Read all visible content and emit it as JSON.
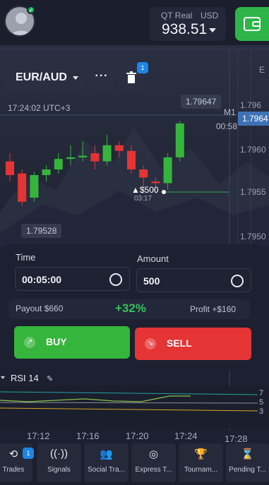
{
  "header": {
    "account_label": "QT Real",
    "currency": "USD",
    "balance": "938.51",
    "avatar_badge": "✓"
  },
  "chart": {
    "pair": "EUR/AUD",
    "more_label": "···",
    "trash_badge": "1",
    "timestamp": "17:24:02 UTC+3",
    "high_tag": "1.79647",
    "low_tag": "1.79528",
    "current_price": "1.7964",
    "timeframe": "M1",
    "timeframe_countdown": "00:58",
    "deal_label": "▲$500",
    "deal_time": "03:17",
    "price_axis": [
      "1.796",
      "1.7960",
      "1.7955",
      "1.7950"
    ],
    "top_right_label": "E",
    "chart_data": {
      "type": "candlestick",
      "colors": {
        "up": "#36b53c",
        "down": "#e53434"
      },
      "candles": [
        {
          "o": 1.79595,
          "h": 1.79605,
          "c": 1.79578,
          "l": 1.7957
        },
        {
          "o": 1.7958,
          "h": 1.79585,
          "c": 1.79545,
          "l": 1.7954
        },
        {
          "o": 1.7955,
          "h": 1.79582,
          "c": 1.79578,
          "l": 1.79545
        },
        {
          "o": 1.79578,
          "h": 1.7959,
          "c": 1.79585,
          "l": 1.7957
        },
        {
          "o": 1.79585,
          "h": 1.79605,
          "c": 1.79598,
          "l": 1.7958
        },
        {
          "o": 1.79598,
          "h": 1.79615,
          "c": 1.796,
          "l": 1.7959
        },
        {
          "o": 1.796,
          "h": 1.7962,
          "c": 1.79602,
          "l": 1.79595
        },
        {
          "o": 1.79605,
          "h": 1.79615,
          "c": 1.79595,
          "l": 1.79585
        },
        {
          "o": 1.79595,
          "h": 1.79628,
          "c": 1.79615,
          "l": 1.7959
        },
        {
          "o": 1.79615,
          "h": 1.7962,
          "c": 1.79608,
          "l": 1.796
        },
        {
          "o": 1.79608,
          "h": 1.79615,
          "c": 1.79585,
          "l": 1.7958
        },
        {
          "o": 1.79585,
          "h": 1.7959,
          "c": 1.79575,
          "l": 1.7956
        },
        {
          "o": 1.7957,
          "h": 1.79575,
          "c": 1.79568,
          "l": 1.79555
        },
        {
          "o": 1.79568,
          "h": 1.79605,
          "c": 1.796,
          "l": 1.7956
        },
        {
          "o": 1.796,
          "h": 1.79645,
          "c": 1.79642,
          "l": 1.79595
        }
      ]
    }
  },
  "panel": {
    "time_label": "Time",
    "time_value": "00:05:00",
    "amount_label": "Amount",
    "amount_value": "500",
    "payout_text": "Payout  $660",
    "payout_percent": "+32%",
    "profit_text": "Profit  +$160",
    "buy_label": "BUY",
    "sell_label": "SELL"
  },
  "rsi": {
    "label": "RSI 14",
    "levels": [
      "7",
      "5",
      "3"
    ]
  },
  "time_axis": [
    "17:12",
    "17:16",
    "17:20",
    "17:24",
    "17:28"
  ],
  "nav": [
    {
      "label": "Trades",
      "icon": "history-icon",
      "badge": "1"
    },
    {
      "label": "Signals",
      "icon": "signal-icon"
    },
    {
      "label": "Social Tra...",
      "icon": "users-icon"
    },
    {
      "label": "Express T...",
      "icon": "target-icon"
    },
    {
      "label": "Tournam...",
      "icon": "trophy-icon"
    },
    {
      "label": "Pending T...",
      "icon": "hourglass-icon"
    }
  ]
}
